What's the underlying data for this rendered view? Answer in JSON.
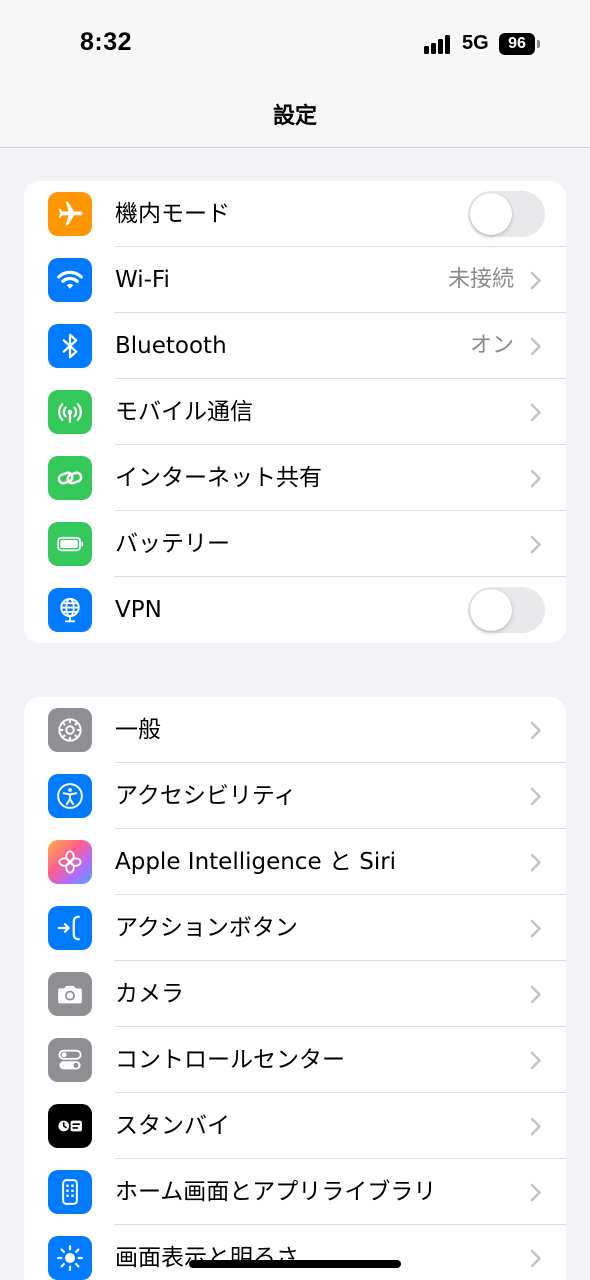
{
  "status_bar": {
    "time": "8:32",
    "network": "5G",
    "battery": "96"
  },
  "nav": {
    "title": "設定"
  },
  "groups": [
    {
      "rows": [
        {
          "label": "機内モード",
          "icon": "airplane-icon",
          "color": "#FF9500",
          "toggle": false
        },
        {
          "label": "Wi-Fi",
          "icon": "wifi-icon",
          "color": "#007AFF",
          "value": "未接続"
        },
        {
          "label": "Bluetooth",
          "icon": "bluetooth-icon",
          "color": "#007AFF",
          "value": "オン"
        },
        {
          "label": "モバイル通信",
          "icon": "antenna-icon",
          "color": "#34C759"
        },
        {
          "label": "インターネット共有",
          "icon": "chain-link-icon",
          "color": "#34C759"
        },
        {
          "label": "バッテリー",
          "icon": "battery-icon",
          "color": "#34C759"
        },
        {
          "label": "VPN",
          "icon": "globe-network-icon",
          "color": "#007AFF",
          "toggle": false
        }
      ]
    },
    {
      "rows": [
        {
          "label": "一般",
          "icon": "gear-icon",
          "color": "#8E8E93"
        },
        {
          "label": "アクセシビリティ",
          "icon": "accessibility-icon",
          "color": "#007AFF"
        },
        {
          "label": "Apple Intelligence と Siri",
          "icon": "apple-intelligence-icon",
          "color": "#FF6AA0"
        },
        {
          "label": "アクションボタン",
          "icon": "action-button-icon",
          "color": "#007AFF"
        },
        {
          "label": "カメラ",
          "icon": "camera-icon",
          "color": "#8E8E93"
        },
        {
          "label": "コントロールセンター",
          "icon": "switches-icon",
          "color": "#8E8E93"
        },
        {
          "label": "スタンバイ",
          "icon": "standby-icon",
          "color": "#000000"
        },
        {
          "label": "ホーム画面とアプリライブラリ",
          "icon": "phone-grid-icon",
          "color": "#007AFF"
        },
        {
          "label": "画面表示と明るさ",
          "icon": "sun-icon",
          "color": "#007AFF"
        }
      ]
    }
  ]
}
